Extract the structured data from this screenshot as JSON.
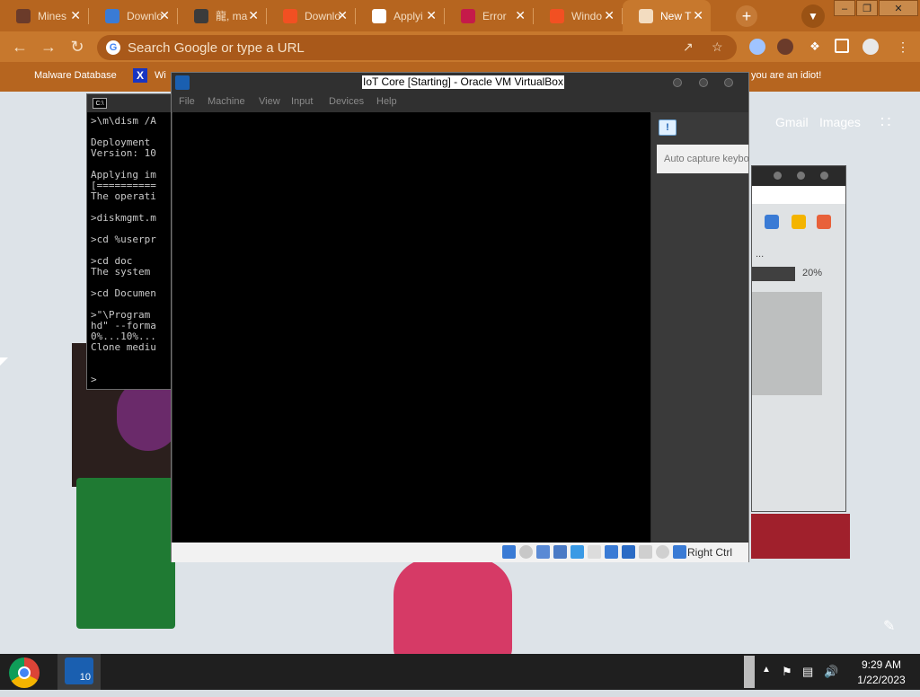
{
  "browser": {
    "tabs": [
      {
        "title": "Mines",
        "icon_color": "#6b3b2a"
      },
      {
        "title": "Downlo",
        "icon_color": "#3a7bd5"
      },
      {
        "title": "龍, ma",
        "icon_color": "#3b3b3b"
      },
      {
        "title": "Downlo",
        "icon_color": "#f25022"
      },
      {
        "title": "Applyi",
        "icon_color": "#ffffff"
      },
      {
        "title": "Error",
        "icon_color": "#c51a4a"
      },
      {
        "title": "Windo",
        "icon_color": "#f25022"
      },
      {
        "title": "New T",
        "icon_color": "#f3dcc0"
      }
    ],
    "omnibox_placeholder": "Search Google or type a URL",
    "bookmarks": [
      "Malware Database",
      "Wi",
      "you are an idiot!"
    ],
    "theme_color": "#b6651f"
  },
  "newtab": {
    "gmail": "Gmail",
    "images": "Images"
  },
  "console": {
    "lines": [
      ">\\m\\dism /A",
      "",
      "Deployment",
      "Version: 10",
      "",
      "Applying im",
      "[==========",
      "The operati",
      "",
      ">diskmgmt.m",
      "",
      ">cd %userpr",
      "",
      ">cd doc",
      "The system",
      "",
      ">cd Documen",
      "",
      ">\"\\Program",
      "hd\" --forma",
      "0%...10%...",
      "Clone mediu",
      "",
      "",
      ">"
    ]
  },
  "vbox": {
    "title": "IoT Core [Starting] - Oracle VM VirtualBox",
    "menu": [
      "File",
      "Machine",
      "View",
      "Input",
      "Devices",
      "Help"
    ],
    "notification": "Auto capture keybo",
    "host_key": "Right Ctrl"
  },
  "bgwin": {
    "progress_text": "20%",
    "progress_fraction": 0.2,
    "ellipsis": "..."
  },
  "taskbar": {
    "vbox_badge": "10",
    "time": "9:29 AM",
    "date": "1/22/2023"
  }
}
